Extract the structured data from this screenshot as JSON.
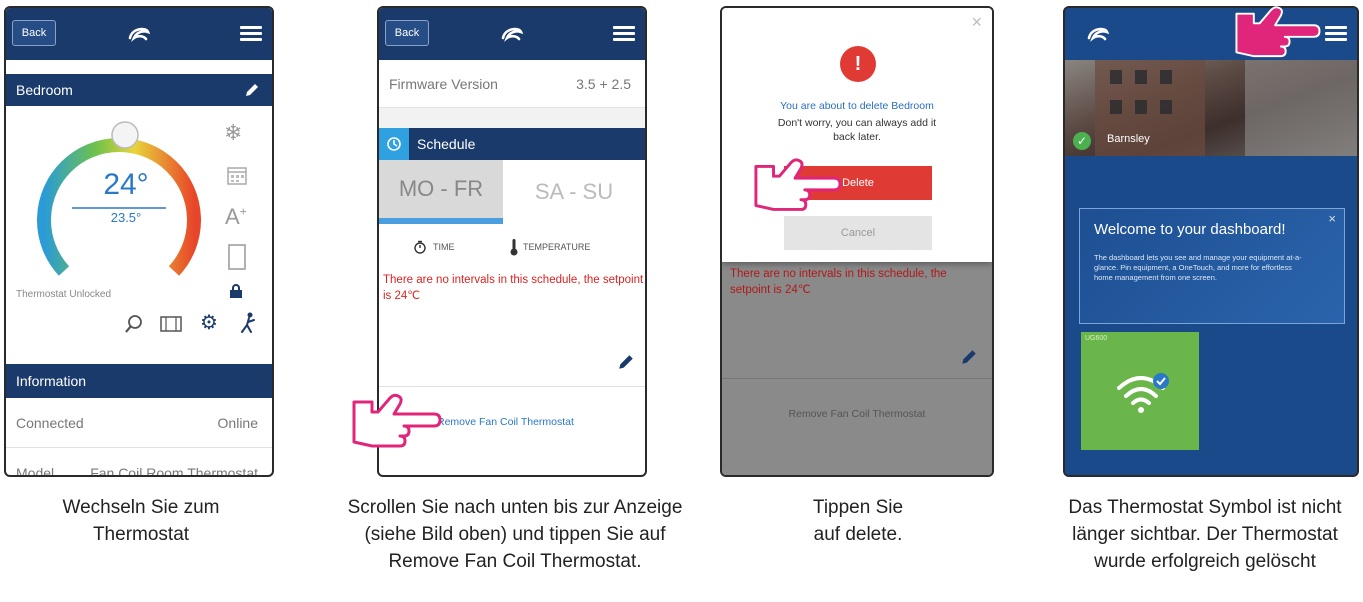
{
  "panel1": {
    "back_label": "Back",
    "room_name": "Bedroom",
    "current_temp": "24°",
    "set_temp": "23.5°",
    "lock_status": "Thermostat Unlocked",
    "info_header": "Information",
    "connected_label": "Connected",
    "connected_value": "Online",
    "model_label": "Model",
    "model_value": "Fan Coil Room Thermostat",
    "caption": [
      "Wechseln Sie zum",
      "Thermostat"
    ]
  },
  "panel2": {
    "back_label": "Back",
    "firmware_label": "Firmware Version",
    "firmware_value": "3.5 + 2.5",
    "schedule_header": "Schedule",
    "tab_weekdays": "MO - FR",
    "tab_weekend": "SA - SU",
    "time_label": "TIME",
    "temperature_label": "TEMPERATURE",
    "no_intervals_msg": "There are no intervals in this schedule, the setpoint is 24℃",
    "remove_link": "Remove Fan Coil Thermostat",
    "caption": [
      "Scrollen Sie nach unten bis zur Anzeige",
      "(siehe Bild oben) und tippen Sie auf",
      "Remove Fan Coil Thermostat."
    ]
  },
  "panel3": {
    "close_symbol": "×",
    "alert_symbol": "!",
    "dialog_line1": "You are about to delete Bedroom",
    "dialog_line2": "Don't worry, you can always add it back later.",
    "delete_label": "Delete",
    "cancel_label": "Cancel",
    "bg_msg": "There are no intervals in this schedule, the setpoint is 24℃",
    "bg_remove": "Remove Fan Coil Thermostat",
    "caption": [
      "Tippen Sie",
      "auf delete."
    ]
  },
  "panel4": {
    "location": "Barnsley",
    "welcome_title": "Welcome to your dashboard!",
    "welcome_close": "×",
    "welcome_body": "The dashboard lets you see and manage your equipment at-a-glance. Pin equipment, a OneTouch, and more for effortless home management from one screen.",
    "tile_label": "UG600",
    "caption": [
      "Das Thermostat Symbol ist nicht",
      "länger sichtbar. Der Thermostat",
      "wurde erfolgreich gelöscht"
    ]
  },
  "colors": {
    "navy": "#1a3a6b",
    "accent_blue": "#2a78c8",
    "delete_red": "#e03a35",
    "warning_red": "#d22",
    "tile_green": "#6ab64a",
    "hand_pink": "#e0267a"
  }
}
